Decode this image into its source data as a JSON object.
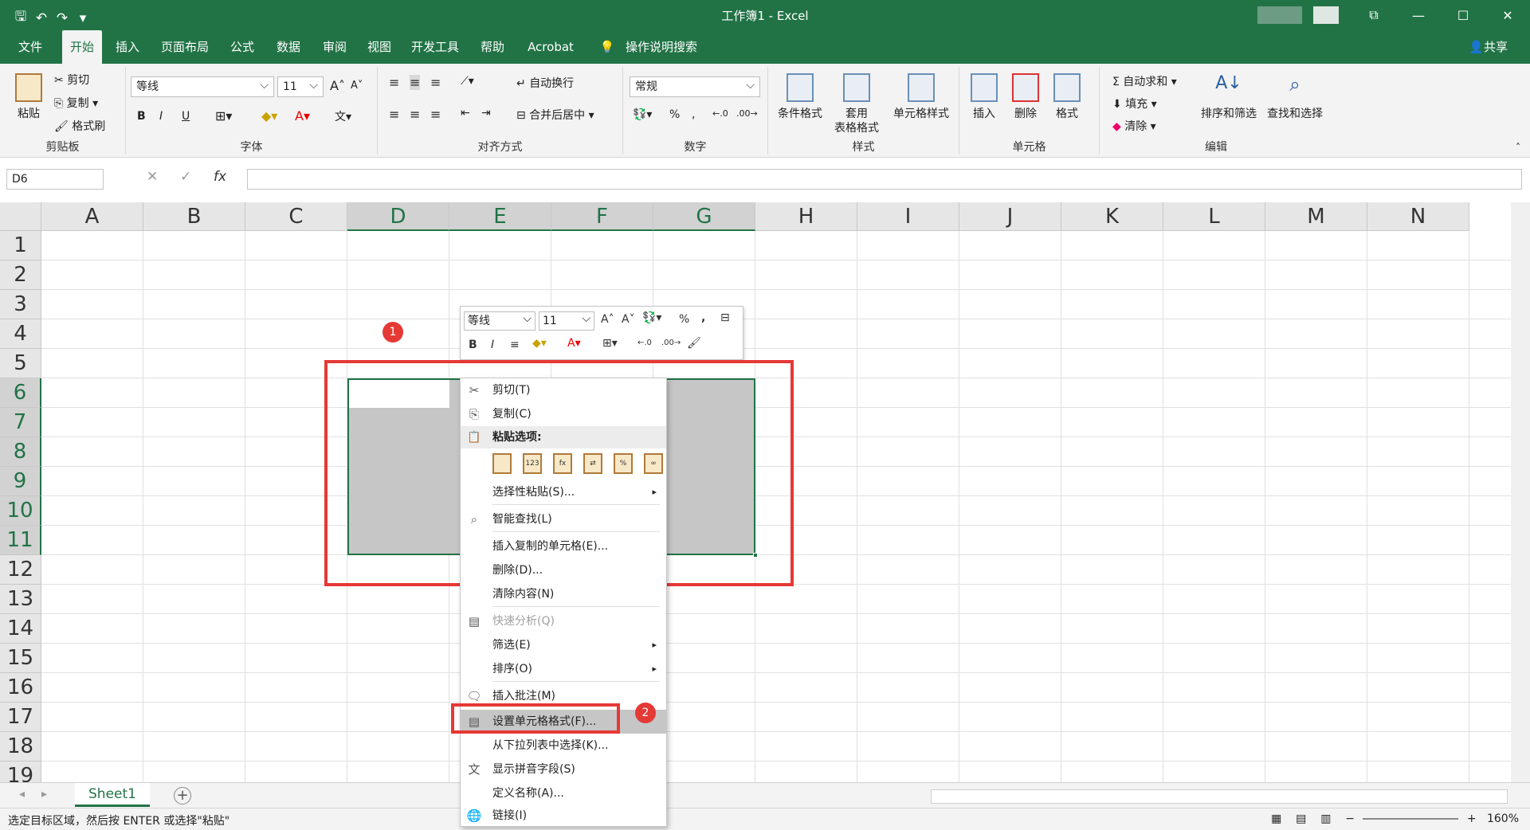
{
  "window": {
    "title": "工作簿1  -  Excel",
    "controls": [
      "⧉",
      "—",
      "☐",
      "✕"
    ]
  },
  "tabs": [
    "文件",
    "开始",
    "插入",
    "页面布局",
    "公式",
    "数据",
    "审阅",
    "视图",
    "开发工具",
    "帮助",
    "Acrobat"
  ],
  "tell_me": "操作说明搜索",
  "share": "共享",
  "ribbon": {
    "clipboard": {
      "paste": "粘贴",
      "cut": "剪切",
      "copy": "复制",
      "format_painter": "格式刷",
      "label": "剪贴板"
    },
    "font": {
      "name": "等线",
      "size": "11",
      "grow": "A",
      "shrink": "A",
      "bold": "B",
      "italic": "I",
      "underline": "U",
      "label": "字体"
    },
    "alignment": {
      "wrap": "自动换行",
      "merge": "合并后居中",
      "label": "对齐方式"
    },
    "number": {
      "format": "常规",
      "percent": "%",
      "comma": ",",
      "label": "数字"
    },
    "styles": {
      "conditional": "条件格式",
      "table_1": "套用",
      "table_2": "表格格式",
      "cell_styles": "单元格样式",
      "label": "样式"
    },
    "cells": {
      "insert": "插入",
      "delete": "删除",
      "format": "格式",
      "label": "单元格"
    },
    "editing": {
      "autosum": "自动求和",
      "fill": "填充",
      "clear": "清除",
      "sort": "排序和筛选",
      "find": "查找和选择",
      "label": "编辑"
    }
  },
  "formula_bar": {
    "name_box": "D6",
    "fx": "fx",
    "cancel": "✕",
    "enter": "✓",
    "value": ""
  },
  "columns": [
    "A",
    "B",
    "C",
    "D",
    "E",
    "F",
    "G",
    "H",
    "I",
    "J",
    "K",
    "L",
    "M",
    "N"
  ],
  "rows": [
    "1",
    "2",
    "3",
    "4",
    "5",
    "6",
    "7",
    "8",
    "9",
    "10",
    "11",
    "12",
    "13",
    "14",
    "15",
    "16",
    "17",
    "18",
    "19"
  ],
  "selection": "D6:G11",
  "badges": [
    "1",
    "2"
  ],
  "mini_toolbar": {
    "font": "等线",
    "size": "11",
    "bold": "B",
    "italic": "I",
    "percent": "%",
    "comma": ","
  },
  "context_menu": {
    "cut": "剪切(T)",
    "copy": "复制(C)",
    "paste_options": "粘贴选项:",
    "paste_special": "选择性粘贴(S)...",
    "smart_lookup": "智能查找(L)",
    "insert_copied": "插入复制的单元格(E)...",
    "delete": "删除(D)...",
    "clear": "清除内容(N)",
    "quick_analysis": "快速分析(Q)",
    "filter": "筛选(E)",
    "sort": "排序(O)",
    "insert_comment": "插入批注(M)",
    "format_cells": "设置单元格格式(F)...",
    "pick_list": "从下拉列表中选择(K)...",
    "phonetic": "显示拼音字段(S)",
    "define_name": "定义名称(A)...",
    "link": "链接(I)"
  },
  "sheet": {
    "tab": "Sheet1"
  },
  "status": {
    "text": "选定目标区域，然后按 ENTER 或选择\"粘贴\"",
    "zoom": "160%"
  }
}
